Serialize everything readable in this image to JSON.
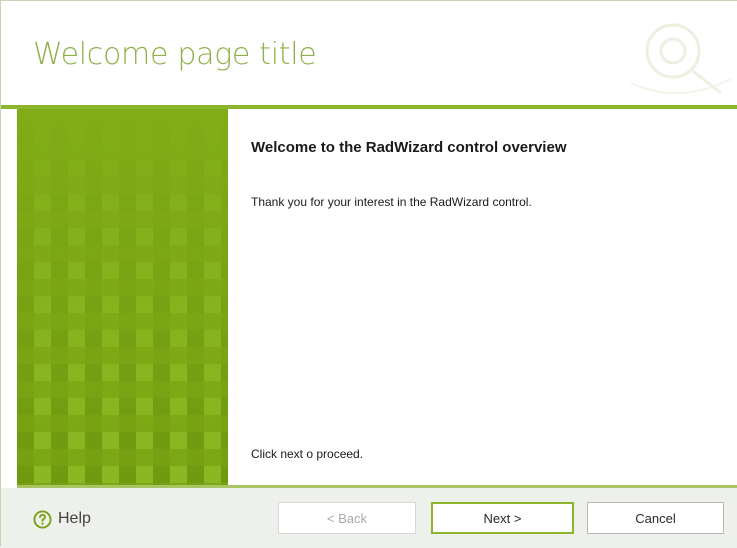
{
  "header": {
    "title": "Welcome page title"
  },
  "page": {
    "heading": "Welcome to the RadWizard control overview",
    "message": "Thank you for your interest in the RadWizard control.",
    "instruction": "Click next o proceed."
  },
  "footer": {
    "help_label": "Help",
    "back_label": "< Back",
    "next_label": "Next >",
    "cancel_label": "Cancel"
  },
  "colors": {
    "accent": "#8db52b",
    "side_panel": "#81ac16",
    "title": "#8eb24a",
    "footer_bg": "#eef0ec"
  },
  "icons": {
    "help": "help-circle-icon",
    "header": "header-watermark-icon"
  }
}
